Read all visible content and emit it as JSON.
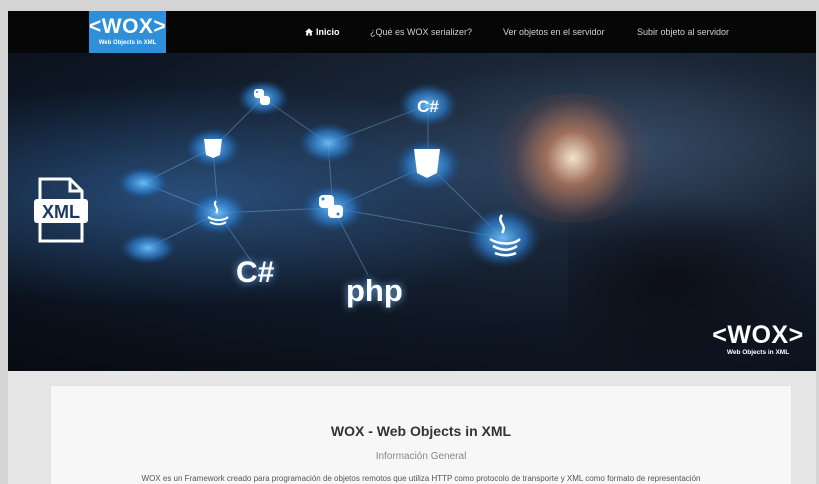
{
  "navbar": {
    "logo": {
      "title": "<WOX>",
      "subtitle": "Web Objects in XML"
    },
    "items": [
      {
        "label": "Inicio",
        "active": true,
        "icon": "home-icon"
      },
      {
        "label": "¿Qué es WOX serializer?"
      },
      {
        "label": "Ver objetos en el servidor"
      },
      {
        "label": "Subir objeto al servidor"
      }
    ],
    "background": "#060606",
    "logo_color": "#2f8fd8"
  },
  "hero": {
    "node_labels": [
      "C#",
      "XML"
    ],
    "big_text": [
      "C#",
      "php"
    ],
    "logo": {
      "title": "<WOX>",
      "subtitle": "Web Objects in XML"
    },
    "icons": [
      "python-icon",
      "java-icon",
      "xml-file-icon",
      "html5-icon"
    ]
  },
  "content": {
    "title": "WOX - Web Objects in XML",
    "subtitle": "Información General",
    "paragraph": "WOX es un Framework creado para programación de objetos remotos que utiliza HTTP como protocolo de transporte y XML como formato de representación"
  }
}
